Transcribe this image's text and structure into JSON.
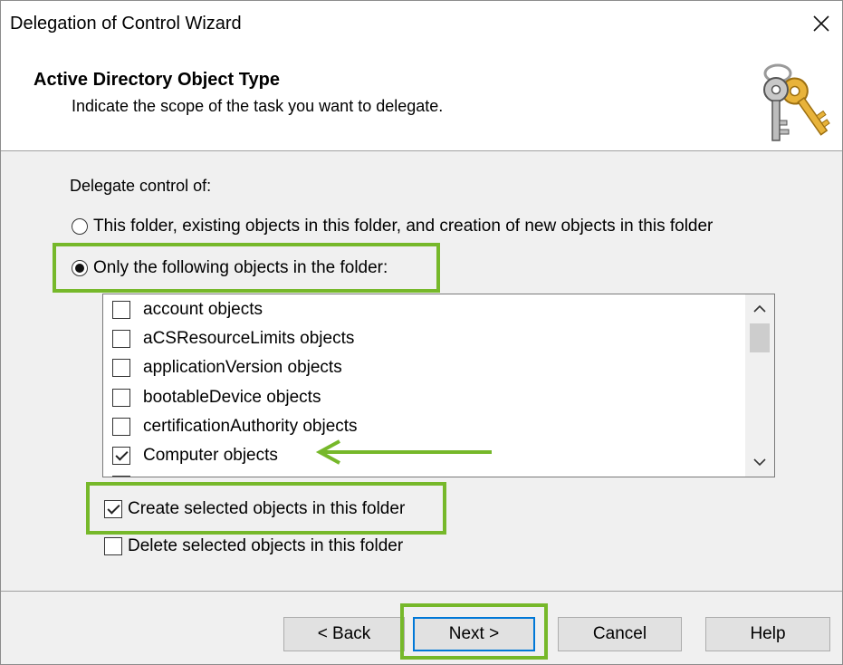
{
  "window": {
    "title": "Delegation of Control Wizard"
  },
  "header": {
    "title": "Active Directory Object Type",
    "subtitle": "Indicate the scope of the task you want to delegate.",
    "icon": "keys-icon"
  },
  "body": {
    "delegate_label": "Delegate control of:",
    "radio_all": {
      "label": "This folder, existing objects in this folder, and creation of new objects in this folder",
      "checked": false
    },
    "radio_only": {
      "label": "Only the following objects in the folder:",
      "checked": true
    },
    "objects": [
      {
        "label": "account objects",
        "checked": false
      },
      {
        "label": "aCSResourceLimits objects",
        "checked": false
      },
      {
        "label": "applicationVersion objects",
        "checked": false
      },
      {
        "label": "bootableDevice objects",
        "checked": false
      },
      {
        "label": "certificationAuthority objects",
        "checked": false
      },
      {
        "label": "Computer objects",
        "checked": true
      }
    ],
    "create_option": {
      "label": "Create selected objects in this folder",
      "checked": true
    },
    "delete_option": {
      "label": "Delete selected objects in this folder",
      "checked": false
    }
  },
  "buttons": {
    "back": "< Back",
    "next": "Next >",
    "cancel": "Cancel",
    "help": "Help"
  },
  "colors": {
    "highlight": "#76b82a",
    "arrow": "#76b82a",
    "default_button_border": "#0078d7"
  }
}
